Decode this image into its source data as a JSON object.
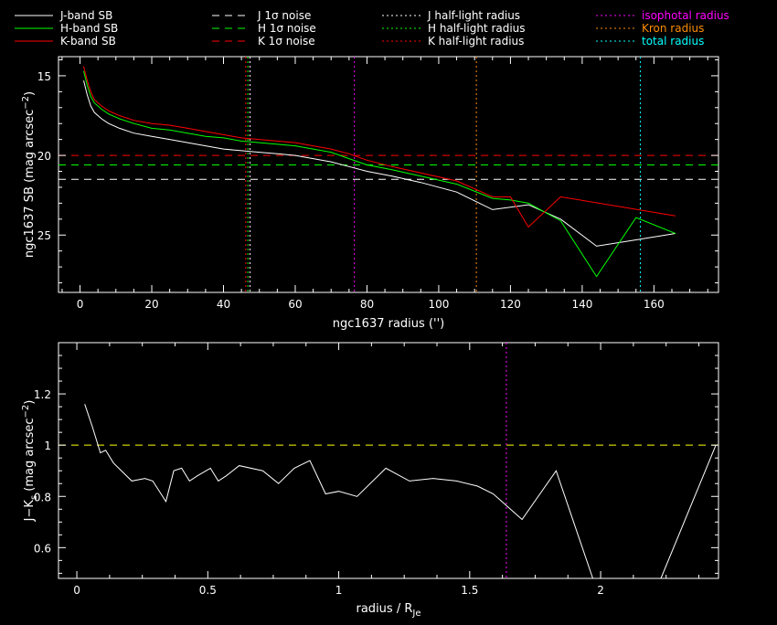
{
  "legend": {
    "columns": [
      [
        {
          "label": "J-band SB",
          "color": "#ffffff",
          "dash": "solid"
        },
        {
          "label": "H-band SB",
          "color": "#00ff00",
          "dash": "solid"
        },
        {
          "label": "K-band SB",
          "color": "#ff0000",
          "dash": "solid"
        }
      ],
      [
        {
          "label": "J 1σ noise",
          "color": "#ffffff",
          "dash": "dashed"
        },
        {
          "label": "H 1σ noise",
          "color": "#00ff00",
          "dash": "dashed"
        },
        {
          "label": "K 1σ noise",
          "color": "#ff0000",
          "dash": "dashed"
        }
      ],
      [
        {
          "label": "J half-light radius",
          "color": "#ffffff",
          "dash": "dotted"
        },
        {
          "label": "H half-light radius",
          "color": "#00ff00",
          "dash": "dotted"
        },
        {
          "label": "K half-light radius",
          "color": "#ff0000",
          "dash": "dotted"
        }
      ],
      [
        {
          "label": "isophotal radius",
          "color": "#ff00ff",
          "dash": "dotted",
          "text_color": "#ff00ff"
        },
        {
          "label": "Kron radius",
          "color": "#ff8c00",
          "dash": "dotted",
          "text_color": "#ff8c00"
        },
        {
          "label": "total radius",
          "color": "#00ffff",
          "dash": "dotted",
          "text_color": "#00ffff"
        }
      ]
    ]
  },
  "chart_data": [
    {
      "type": "line",
      "xlabel": "ngc1637 radius ('')",
      "ylabel": "ngc1637 SB (mag arcsec^-2)",
      "xlim": [
        -6,
        178
      ],
      "ylim": [
        28.6,
        13.8
      ],
      "inverted_y": true,
      "xticks": [
        0,
        20,
        40,
        60,
        80,
        100,
        120,
        140,
        160
      ],
      "yticks": [
        15,
        20,
        25
      ],
      "series": [
        {
          "name": "J-band SB",
          "color": "#ffffff",
          "x": [
            1,
            2,
            3,
            4,
            6,
            8,
            11,
            15,
            20,
            25,
            30,
            35,
            40,
            45,
            50,
            55,
            60,
            65,
            70,
            75,
            80,
            87,
            95,
            105,
            115,
            125,
            134,
            144,
            155,
            166
          ],
          "y": [
            15.3,
            16.2,
            16.9,
            17.3,
            17.7,
            18.0,
            18.3,
            18.6,
            18.8,
            19.0,
            19.2,
            19.4,
            19.6,
            19.7,
            19.8,
            19.9,
            20.0,
            20.2,
            20.4,
            20.7,
            21.0,
            21.3,
            21.7,
            22.3,
            23.4,
            23.1,
            24.0,
            25.7,
            25.3,
            24.9
          ]
        },
        {
          "name": "H-band SB",
          "color": "#00ff00",
          "x": [
            1,
            2,
            3,
            4,
            6,
            8,
            11,
            15,
            20,
            25,
            30,
            35,
            40,
            45,
            50,
            55,
            60,
            65,
            70,
            75,
            80,
            87,
            95,
            105,
            115,
            120,
            125,
            134,
            144,
            155,
            166
          ],
          "y": [
            14.7,
            15.6,
            16.3,
            16.7,
            17.1,
            17.4,
            17.7,
            18.0,
            18.3,
            18.4,
            18.6,
            18.8,
            18.9,
            19.1,
            19.2,
            19.3,
            19.4,
            19.6,
            19.8,
            20.2,
            20.6,
            20.9,
            21.3,
            21.8,
            22.7,
            22.8,
            23.0,
            24.1,
            27.6,
            23.9,
            24.9
          ]
        },
        {
          "name": "K-band SB",
          "color": "#ff0000",
          "x": [
            1,
            2,
            3,
            4,
            6,
            8,
            11,
            15,
            20,
            25,
            30,
            35,
            40,
            45,
            50,
            55,
            60,
            65,
            70,
            75,
            80,
            87,
            95,
            105,
            115,
            120,
            125,
            134,
            166
          ],
          "y": [
            14.4,
            15.3,
            16.0,
            16.5,
            16.9,
            17.2,
            17.5,
            17.8,
            18.0,
            18.1,
            18.3,
            18.5,
            18.7,
            18.9,
            19.0,
            19.1,
            19.2,
            19.4,
            19.6,
            19.9,
            20.3,
            20.7,
            21.1,
            21.6,
            22.6,
            22.6,
            24.5,
            22.6,
            23.8
          ]
        }
      ],
      "hlines": [
        {
          "name": "J 1σ noise",
          "y": 21.5,
          "color": "#ffffff",
          "dash": "dashed"
        },
        {
          "name": "H 1σ noise",
          "y": 20.6,
          "color": "#00ff00",
          "dash": "dashed"
        },
        {
          "name": "K 1σ noise",
          "y": 20.0,
          "color": "#ff0000",
          "dash": "dashed"
        }
      ],
      "vlines": [
        {
          "name": "J half-light radius",
          "x": 47.4,
          "color": "#ffffff",
          "dash": "dotted"
        },
        {
          "name": "H half-light radius",
          "x": 46.8,
          "color": "#00ff00",
          "dash": "dotted"
        },
        {
          "name": "K half-light radius",
          "x": 46.2,
          "color": "#ff0000",
          "dash": "dotted"
        },
        {
          "name": "isophotal radius",
          "x": 76.5,
          "color": "#ff00ff",
          "dash": "dotted"
        },
        {
          "name": "Kron radius",
          "x": 110.5,
          "color": "#ff8c00",
          "dash": "dotted"
        },
        {
          "name": "total radius",
          "x": 156.2,
          "color": "#00ffff",
          "dash": "dotted"
        }
      ]
    },
    {
      "type": "line",
      "xlabel": "radius / R_Je",
      "ylabel": "J-K_s (mag arcsec^-2)",
      "xlim": [
        -0.07,
        2.45
      ],
      "ylim": [
        0.48,
        1.4
      ],
      "xticks": [
        0,
        0.5,
        1,
        1.5,
        2
      ],
      "xtick_labels": [
        "0",
        "0.5",
        "1",
        "1.5",
        "2"
      ],
      "yticks": [
        0.6,
        0.8,
        1,
        1.2
      ],
      "ytick_labels": [
        "0.6",
        "0.8",
        "1",
        "1.2"
      ],
      "series": [
        {
          "name": "",
          "color": "#ffffff",
          "x": [
            0.03,
            0.06,
            0.09,
            0.11,
            0.14,
            0.21,
            0.26,
            0.29,
            0.34,
            0.37,
            0.4,
            0.43,
            0.46,
            0.51,
            0.54,
            0.57,
            0.62,
            0.71,
            0.77,
            0.83,
            0.89,
            0.95,
            1.0,
            1.07,
            1.18,
            1.27,
            1.36,
            1.45,
            1.53,
            1.59,
            1.7,
            1.83,
            1.97,
            2.14,
            2.23,
            2.44
          ],
          "y": [
            1.16,
            1.07,
            0.97,
            0.98,
            0.93,
            0.86,
            0.87,
            0.86,
            0.78,
            0.9,
            0.91,
            0.86,
            0.88,
            0.91,
            0.86,
            0.88,
            0.92,
            0.9,
            0.85,
            0.91,
            0.94,
            0.81,
            0.82,
            0.8,
            0.91,
            0.86,
            0.87,
            0.86,
            0.84,
            0.81,
            0.71,
            0.9,
            0.48,
            0.36,
            0.48,
            1.0
          ]
        }
      ],
      "hlines": [
        {
          "name": "",
          "y": 1.0,
          "color": "#ffff00",
          "dash": "dashed"
        }
      ],
      "vlines": [
        {
          "name": "isophotal radius",
          "x": 1.64,
          "color": "#ff00ff",
          "dash": "dotted"
        }
      ]
    }
  ],
  "axis_labels": {
    "top_x": "ngc1637 radius ('')",
    "top_y": "ngc1637 SB (mag arcsec",
    "top_y_sup": "−2",
    "top_y_close": ")",
    "bot_x": "radius / R",
    "bot_x_sub": "Je",
    "bot_y": "J−K",
    "bot_y_sub": "s",
    "bot_y_rest": " (mag arcsec",
    "bot_y_sup": "−2",
    "bot_y_close": ")"
  }
}
